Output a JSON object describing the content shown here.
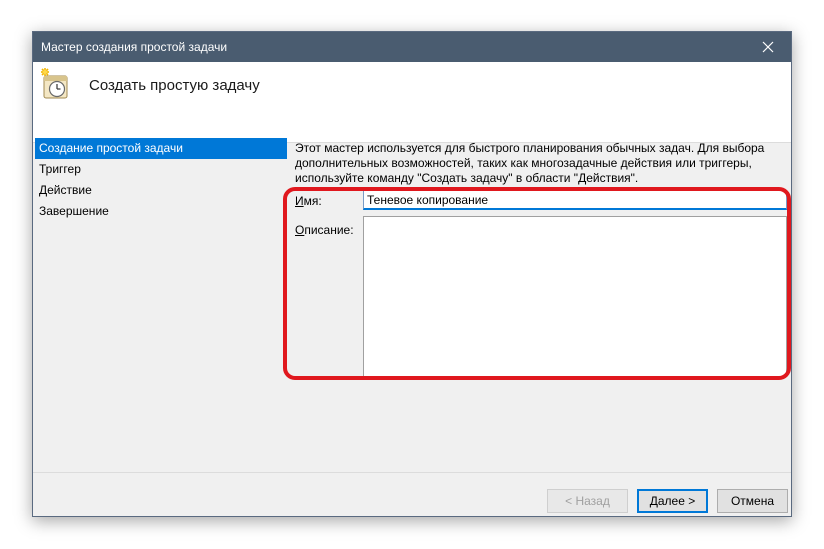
{
  "window": {
    "title": "Мастер создания простой задачи",
    "close_icon": "close-icon"
  },
  "header": {
    "icon": "task-scheduler-clock-icon",
    "title": "Создать простую задачу"
  },
  "sidebar": {
    "items": [
      {
        "label": "Создание простой задачи",
        "active": true
      },
      {
        "label": "Триггер",
        "active": false
      },
      {
        "label": "Действие",
        "active": false
      },
      {
        "label": "Завершение",
        "active": false
      }
    ]
  },
  "main": {
    "description_lines": [
      "Этот мастер используется для быстрого планирования обычных задач.  Для выбора",
      "дополнительных возможностей, таких как многозадачные действия или триггеры,",
      "используйте команду \"Создать задачу\" в области \"Действия\"."
    ],
    "name_label_accel": "И",
    "name_label_rest": "мя:",
    "name_value": "Теневое копирование",
    "description_label_accel": "О",
    "description_label_rest": "писание:",
    "description_value": ""
  },
  "buttons": {
    "back": "< Назад",
    "next": "Далее >",
    "cancel": "Отмена"
  },
  "colors": {
    "titlebar": "#4a5c70",
    "accent": "#0078d7",
    "highlight": "#e0181e"
  }
}
